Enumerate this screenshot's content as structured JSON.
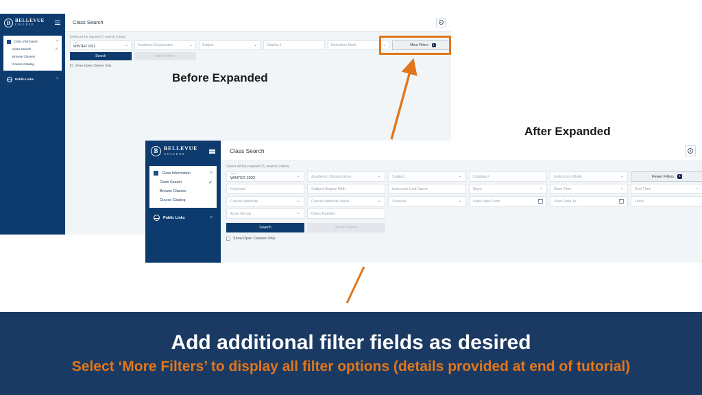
{
  "brand": {
    "seal_letter": "B",
    "line1": "BELLEVUE",
    "line2": "C O L L E G E"
  },
  "sidebar": {
    "group": {
      "label": "Class Information",
      "icon": "grid-icon",
      "caret": "˄"
    },
    "items": [
      {
        "label": "Class Search",
        "selected": true,
        "check": "✓"
      },
      {
        "label": "Browse Classes",
        "selected": false,
        "check": ""
      },
      {
        "label": "Course Catalog",
        "selected": false,
        "check": ""
      }
    ],
    "public_links": {
      "label": "Public Links",
      "icon": "globe-icon",
      "caret": "˅"
    }
  },
  "topbar": {
    "title": "Class Search",
    "gear_icon": "gear-icon"
  },
  "before_panel": {
    "caption": "Before Expanded",
    "criteria_note": "Select all the required (*) search criteria.",
    "fields": [
      {
        "name": "term",
        "mini_label": "Term *",
        "value": "WINTER 2022",
        "type": "select"
      },
      {
        "name": "academic-organization",
        "placeholder": "Academic Organization",
        "type": "select"
      },
      {
        "name": "subject",
        "placeholder": "Subject",
        "type": "select"
      },
      {
        "name": "catalog-number",
        "placeholder": "Catalog #",
        "type": "text"
      },
      {
        "name": "instruction-mode",
        "placeholder": "Instruction Mode",
        "type": "select"
      }
    ],
    "more_filters": {
      "label": "More Filters",
      "badge": "1"
    },
    "search_button": "Search",
    "reset_button": "Reset Filters",
    "checkbox": {
      "label": "Show Open Classes Only",
      "checked": false
    }
  },
  "after_panel": {
    "caption": "After Expanded",
    "criteria_note": "Select all the required (*) search criteria.",
    "row1": [
      {
        "name": "term",
        "mini_label": "Term *",
        "value": "WINTER 2022",
        "type": "select"
      },
      {
        "name": "academic-organization",
        "placeholder": "Academic Organization",
        "type": "select"
      },
      {
        "name": "subject",
        "placeholder": "Subject",
        "type": "select"
      },
      {
        "name": "catalog-number",
        "placeholder": "Catalog #",
        "type": "text"
      },
      {
        "name": "instruction-mode",
        "placeholder": "Instruction Mode",
        "type": "select"
      }
    ],
    "row2": [
      {
        "name": "keyword",
        "placeholder": "Keyword",
        "type": "text"
      },
      {
        "name": "subject-begins-with",
        "placeholder": "Subject Begins With",
        "type": "text"
      },
      {
        "name": "instructor-last-name",
        "placeholder": "Instructor Last Name",
        "type": "text"
      },
      {
        "name": "days",
        "placeholder": "Days",
        "type": "select"
      },
      {
        "name": "start-time",
        "placeholder": "Start Time",
        "type": "select"
      },
      {
        "name": "end-time",
        "placeholder": "End Time",
        "type": "select"
      }
    ],
    "row3": [
      {
        "name": "course-attribute",
        "placeholder": "Course Attribute",
        "type": "select"
      },
      {
        "name": "course-attribute-value",
        "placeholder": "Course Attribute Value",
        "type": "select"
      },
      {
        "name": "session",
        "placeholder": "Session",
        "type": "select"
      },
      {
        "name": "start-date-from",
        "placeholder": "Start Date From",
        "type": "date"
      },
      {
        "name": "start-date-to",
        "placeholder": "Start Date To",
        "type": "date"
      },
      {
        "name": "units",
        "placeholder": "Units",
        "type": "text"
      }
    ],
    "row4": [
      {
        "name": "acad-group",
        "placeholder": "Acad Group",
        "type": "select"
      },
      {
        "name": "class-number",
        "placeholder": "Class Number",
        "type": "text"
      }
    ],
    "fewer_filters": {
      "label": "Fewer Filters",
      "badge": "1"
    },
    "search_button": "Search",
    "reset_button": "Reset Filters",
    "checkbox": {
      "label": "Show Open Classes Only",
      "checked": false
    }
  },
  "footer": {
    "line1": "Add additional filter fields as desired",
    "line2": "Select ‘More Filters’ to display all filter options (details provided at end of tutorial)"
  },
  "colors": {
    "brand_navy": "#0d3b6e",
    "footer_navy": "#1b3a63",
    "accent_orange": "#e2761b",
    "panel_bg": "#f2f5f7",
    "badge_navy": "#13294b"
  }
}
